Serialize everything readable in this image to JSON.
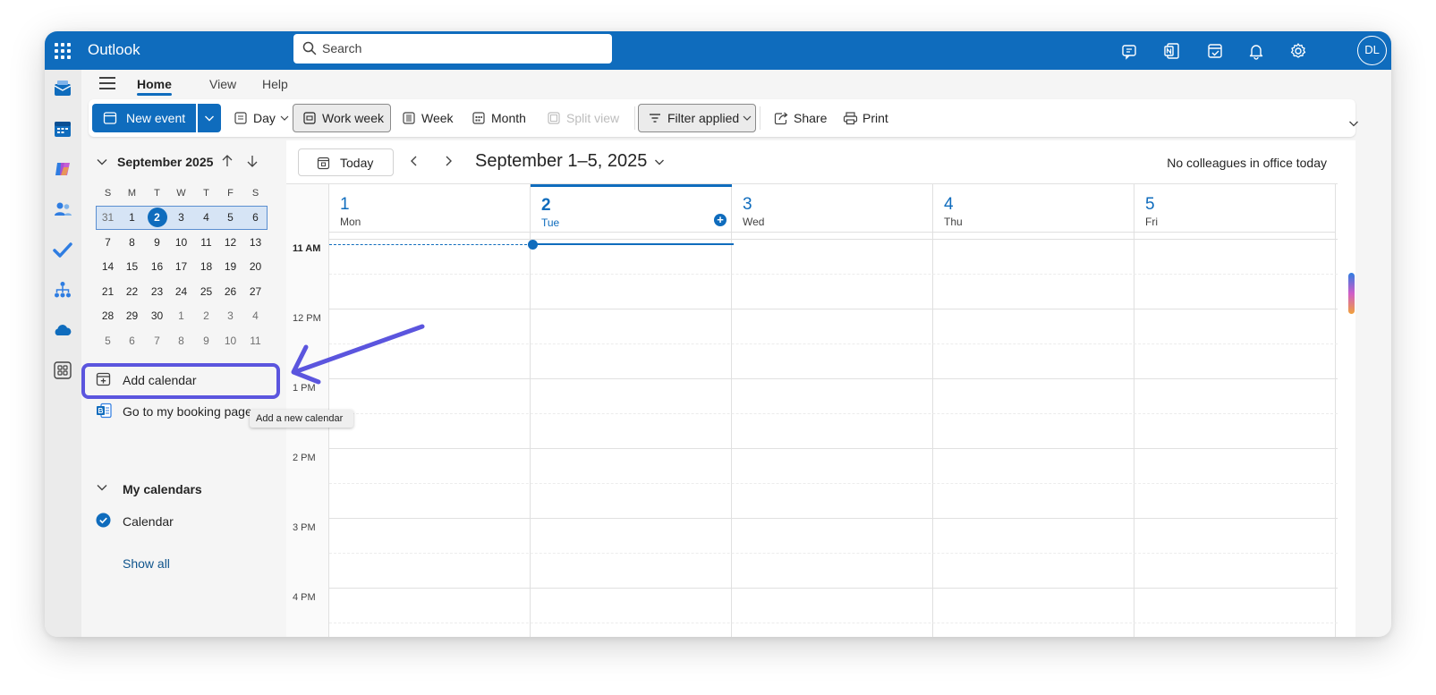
{
  "app": {
    "title": "Outlook",
    "avatar_initials": "DL",
    "brand_color": "#0f6cbd",
    "annotation_color": "#5b55de"
  },
  "search": {
    "placeholder": "Search"
  },
  "topbar_icons": [
    "meet-now-icon",
    "onenote-icon",
    "my-day-icon",
    "bell-icon",
    "gear-icon"
  ],
  "rail_icons": [
    "mail-icon",
    "calendar-icon",
    "copilot-icon",
    "people-icon",
    "todo-icon",
    "org-explorer-icon",
    "onedrive-icon",
    "more-apps-icon"
  ],
  "menu": {
    "tabs": [
      {
        "label": "Home",
        "active": true
      },
      {
        "label": "View",
        "active": false
      },
      {
        "label": "Help",
        "active": false
      }
    ]
  },
  "toolbar": {
    "new_event": "New event",
    "day": "Day",
    "work_week": "Work week",
    "week": "Week",
    "month": "Month",
    "split_view": "Split view",
    "filter": "Filter applied",
    "share": "Share",
    "print": "Print"
  },
  "mini_calendar": {
    "month_label": "September 2025",
    "weekdays": [
      "S",
      "M",
      "T",
      "W",
      "T",
      "F",
      "S"
    ],
    "weeks": [
      [
        "31",
        "1",
        "2",
        "3",
        "4",
        "5",
        "6"
      ],
      [
        "7",
        "8",
        "9",
        "10",
        "11",
        "12",
        "13"
      ],
      [
        "14",
        "15",
        "16",
        "17",
        "18",
        "19",
        "20"
      ],
      [
        "21",
        "22",
        "23",
        "24",
        "25",
        "26",
        "27"
      ],
      [
        "28",
        "29",
        "30",
        "1",
        "2",
        "3",
        "4"
      ],
      [
        "5",
        "6",
        "7",
        "8",
        "9",
        "10",
        "11"
      ]
    ],
    "today": "2"
  },
  "nav": {
    "add_calendar": "Add calendar",
    "booking_page": "Go to my booking page",
    "tooltip": "Add a new calendar",
    "my_calendars": "My calendars",
    "calendar": "Calendar",
    "show_all": "Show all"
  },
  "calendar_view": {
    "today_button": "Today",
    "range": "September 1–5, 2025",
    "colleagues": "No colleagues in office today",
    "days": [
      {
        "num": "1",
        "name": "Mon"
      },
      {
        "num": "2",
        "name": "Tue",
        "today": true
      },
      {
        "num": "3",
        "name": "Wed"
      },
      {
        "num": "4",
        "name": "Thu"
      },
      {
        "num": "5",
        "name": "Fri"
      }
    ],
    "times": [
      "11 AM",
      "12 PM",
      "1 PM",
      "2 PM",
      "3 PM",
      "4 PM"
    ]
  }
}
